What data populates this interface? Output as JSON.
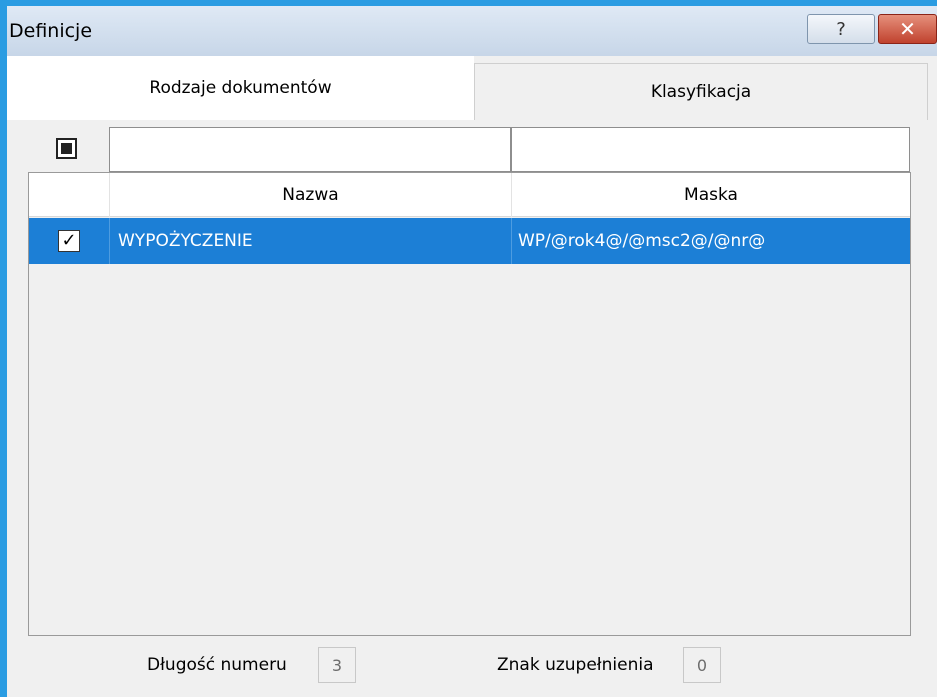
{
  "window": {
    "title": "Definicje",
    "help_glyph": "?",
    "close_glyph": "✕"
  },
  "tabs": [
    {
      "label": "Rodzaje dokumentów",
      "active": true
    },
    {
      "label": "Klasyfikacja",
      "active": false
    }
  ],
  "filters": {
    "name_value": "",
    "mask_value": ""
  },
  "grid": {
    "columns": [
      "",
      "Nazwa",
      "Maska"
    ],
    "rows": [
      {
        "checked": true,
        "check_glyph": "✓",
        "name": "WYPOŻYCZENIE",
        "mask": "WP/@rok4@/@msc2@/@nr@",
        "selected": true
      }
    ]
  },
  "footer": {
    "length_label": "Długość numeru",
    "length_value": "3",
    "fill_label": "Znak uzupełnienia",
    "fill_value": "0"
  },
  "colors": {
    "accent_border": "#2a9ce2",
    "selection": "#1c7fd6",
    "close_button": "#c0422e"
  },
  "icons": {
    "help": "help-icon",
    "close": "close-icon",
    "select_all": "select-all-checkbox-icon",
    "row_check": "checkmark-icon"
  }
}
